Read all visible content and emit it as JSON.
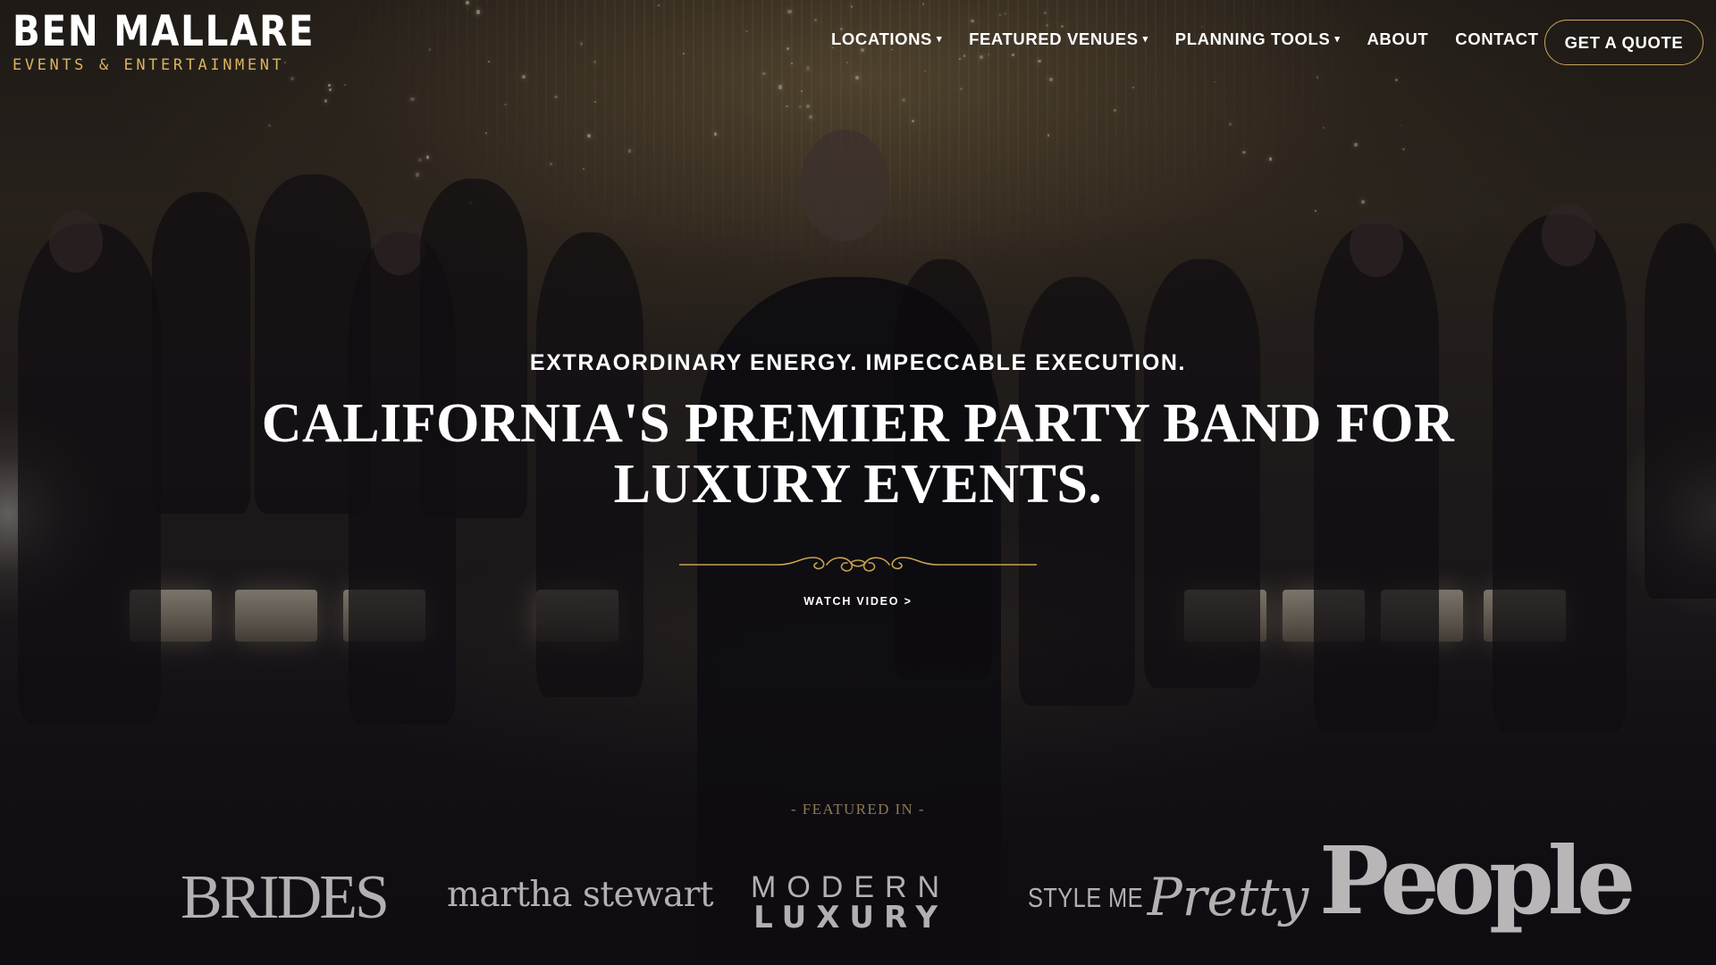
{
  "brand": {
    "name": "BEN MALLARE",
    "tagline": "EVENTS & ENTERTAINMENT",
    "accent_color": "#d9b45e"
  },
  "nav": {
    "items": [
      {
        "label": "LOCATIONS",
        "has_dropdown": true
      },
      {
        "label": "FEATURED VENUES",
        "has_dropdown": true
      },
      {
        "label": "PLANNING TOOLS",
        "has_dropdown": true
      },
      {
        "label": "ABOUT",
        "has_dropdown": false
      },
      {
        "label": "CONTACT",
        "has_dropdown": false
      }
    ],
    "cta_label": "GET A QUOTE",
    "dropdown_icon": "caret-down-icon"
  },
  "hero": {
    "eyebrow": "EXTRAORDINARY ENERGY. IMPECCABLE EXECUTION.",
    "headline_line1": "CALIFORNIA'S PREMIER PARTY BAND FOR",
    "headline_line2": "LUXURY EVENTS.",
    "ornament_icon": "gold-flourish-divider",
    "watch_video_label": "WATCH VIDEO >"
  },
  "featured": {
    "label": "- FEATURED IN -",
    "logos": [
      {
        "name": "brides-logo",
        "text": "BRIDES"
      },
      {
        "name": "martha-stewart-logo",
        "text": "martha stewart"
      },
      {
        "name": "modern-luxury-logo",
        "text_line1": "MODERN",
        "text_line2": "LUXURY"
      },
      {
        "name": "style-me-pretty-logo",
        "text_line1": "STYLE ME",
        "text_line2": "Pretty"
      },
      {
        "name": "people-logo",
        "text": "People"
      }
    ]
  }
}
